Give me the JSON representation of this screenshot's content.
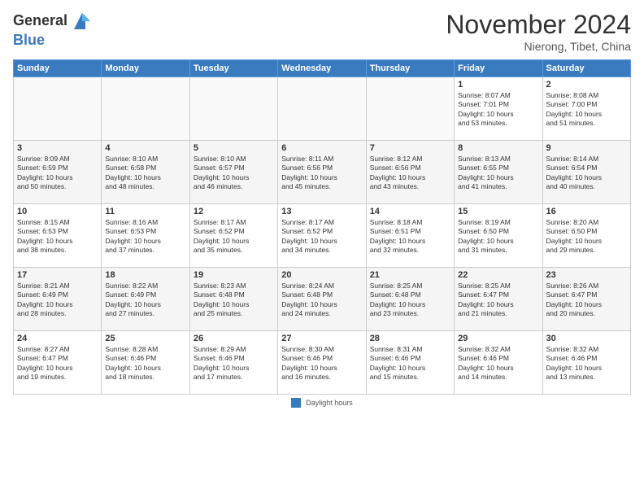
{
  "header": {
    "logo_line1": "General",
    "logo_line2": "Blue",
    "month": "November 2024",
    "location": "Nierong, Tibet, China"
  },
  "days_of_week": [
    "Sunday",
    "Monday",
    "Tuesday",
    "Wednesday",
    "Thursday",
    "Friday",
    "Saturday"
  ],
  "footer": {
    "label": "Daylight hours"
  },
  "weeks": [
    {
      "days": [
        {
          "num": "",
          "info": ""
        },
        {
          "num": "",
          "info": ""
        },
        {
          "num": "",
          "info": ""
        },
        {
          "num": "",
          "info": ""
        },
        {
          "num": "",
          "info": ""
        },
        {
          "num": "1",
          "info": "Sunrise: 8:07 AM\nSunset: 7:01 PM\nDaylight: 10 hours\nand 53 minutes."
        },
        {
          "num": "2",
          "info": "Sunrise: 8:08 AM\nSunset: 7:00 PM\nDaylight: 10 hours\nand 51 minutes."
        }
      ]
    },
    {
      "days": [
        {
          "num": "3",
          "info": "Sunrise: 8:09 AM\nSunset: 6:59 PM\nDaylight: 10 hours\nand 50 minutes."
        },
        {
          "num": "4",
          "info": "Sunrise: 8:10 AM\nSunset: 6:58 PM\nDaylight: 10 hours\nand 48 minutes."
        },
        {
          "num": "5",
          "info": "Sunrise: 8:10 AM\nSunset: 6:57 PM\nDaylight: 10 hours\nand 46 minutes."
        },
        {
          "num": "6",
          "info": "Sunrise: 8:11 AM\nSunset: 6:56 PM\nDaylight: 10 hours\nand 45 minutes."
        },
        {
          "num": "7",
          "info": "Sunrise: 8:12 AM\nSunset: 6:56 PM\nDaylight: 10 hours\nand 43 minutes."
        },
        {
          "num": "8",
          "info": "Sunrise: 8:13 AM\nSunset: 6:55 PM\nDaylight: 10 hours\nand 41 minutes."
        },
        {
          "num": "9",
          "info": "Sunrise: 8:14 AM\nSunset: 6:54 PM\nDaylight: 10 hours\nand 40 minutes."
        }
      ]
    },
    {
      "days": [
        {
          "num": "10",
          "info": "Sunrise: 8:15 AM\nSunset: 6:53 PM\nDaylight: 10 hours\nand 38 minutes."
        },
        {
          "num": "11",
          "info": "Sunrise: 8:16 AM\nSunset: 6:53 PM\nDaylight: 10 hours\nand 37 minutes."
        },
        {
          "num": "12",
          "info": "Sunrise: 8:17 AM\nSunset: 6:52 PM\nDaylight: 10 hours\nand 35 minutes."
        },
        {
          "num": "13",
          "info": "Sunrise: 8:17 AM\nSunset: 6:52 PM\nDaylight: 10 hours\nand 34 minutes."
        },
        {
          "num": "14",
          "info": "Sunrise: 8:18 AM\nSunset: 6:51 PM\nDaylight: 10 hours\nand 32 minutes."
        },
        {
          "num": "15",
          "info": "Sunrise: 8:19 AM\nSunset: 6:50 PM\nDaylight: 10 hours\nand 31 minutes."
        },
        {
          "num": "16",
          "info": "Sunrise: 8:20 AM\nSunset: 6:50 PM\nDaylight: 10 hours\nand 29 minutes."
        }
      ]
    },
    {
      "days": [
        {
          "num": "17",
          "info": "Sunrise: 8:21 AM\nSunset: 6:49 PM\nDaylight: 10 hours\nand 28 minutes."
        },
        {
          "num": "18",
          "info": "Sunrise: 8:22 AM\nSunset: 6:49 PM\nDaylight: 10 hours\nand 27 minutes."
        },
        {
          "num": "19",
          "info": "Sunrise: 8:23 AM\nSunset: 6:48 PM\nDaylight: 10 hours\nand 25 minutes."
        },
        {
          "num": "20",
          "info": "Sunrise: 8:24 AM\nSunset: 6:48 PM\nDaylight: 10 hours\nand 24 minutes."
        },
        {
          "num": "21",
          "info": "Sunrise: 8:25 AM\nSunset: 6:48 PM\nDaylight: 10 hours\nand 23 minutes."
        },
        {
          "num": "22",
          "info": "Sunrise: 8:25 AM\nSunset: 6:47 PM\nDaylight: 10 hours\nand 21 minutes."
        },
        {
          "num": "23",
          "info": "Sunrise: 8:26 AM\nSunset: 6:47 PM\nDaylight: 10 hours\nand 20 minutes."
        }
      ]
    },
    {
      "days": [
        {
          "num": "24",
          "info": "Sunrise: 8:27 AM\nSunset: 6:47 PM\nDaylight: 10 hours\nand 19 minutes."
        },
        {
          "num": "25",
          "info": "Sunrise: 8:28 AM\nSunset: 6:46 PM\nDaylight: 10 hours\nand 18 minutes."
        },
        {
          "num": "26",
          "info": "Sunrise: 8:29 AM\nSunset: 6:46 PM\nDaylight: 10 hours\nand 17 minutes."
        },
        {
          "num": "27",
          "info": "Sunrise: 8:30 AM\nSunset: 6:46 PM\nDaylight: 10 hours\nand 16 minutes."
        },
        {
          "num": "28",
          "info": "Sunrise: 8:31 AM\nSunset: 6:46 PM\nDaylight: 10 hours\nand 15 minutes."
        },
        {
          "num": "29",
          "info": "Sunrise: 8:32 AM\nSunset: 6:46 PM\nDaylight: 10 hours\nand 14 minutes."
        },
        {
          "num": "30",
          "info": "Sunrise: 8:32 AM\nSunset: 6:46 PM\nDaylight: 10 hours\nand 13 minutes."
        }
      ]
    }
  ]
}
